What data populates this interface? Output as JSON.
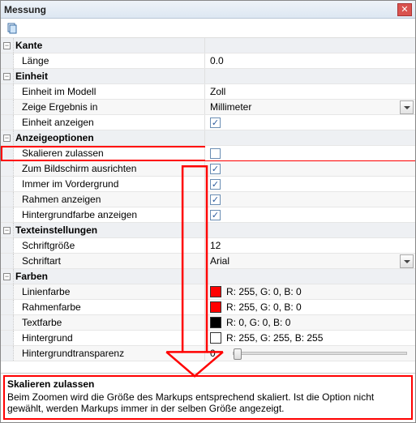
{
  "window": {
    "title": "Messung"
  },
  "sections": {
    "kante": {
      "header": "Kante",
      "laenge": {
        "label": "Länge",
        "value": "0.0"
      }
    },
    "einheit": {
      "header": "Einheit",
      "im_modell": {
        "label": "Einheit im Modell",
        "value": "Zoll"
      },
      "ergebnis_in": {
        "label": "Zeige Ergebnis in",
        "value": "Millimeter"
      },
      "anzeigen": {
        "label": "Einheit anzeigen",
        "checked": true
      }
    },
    "anzeige": {
      "header": "Anzeigeoptionen",
      "skalieren": {
        "label": "Skalieren zulassen",
        "checked": false
      },
      "bildschirm": {
        "label": "Zum Bildschirm ausrichten",
        "checked": true
      },
      "vordergrund": {
        "label": "Immer im Vordergrund",
        "checked": true
      },
      "rahmen": {
        "label": "Rahmen anzeigen",
        "checked": true
      },
      "hg_anzeigen": {
        "label": "Hintergrundfarbe anzeigen",
        "checked": true
      }
    },
    "text": {
      "header": "Texteinstellungen",
      "groesse": {
        "label": "Schriftgröße",
        "value": "12"
      },
      "art": {
        "label": "Schriftart",
        "value": "Arial"
      }
    },
    "farben": {
      "header": "Farben",
      "linie": {
        "label": "Linienfarbe",
        "text": "R: 255, G: 0, B: 0",
        "hex": "#ff0000"
      },
      "rahmen": {
        "label": "Rahmenfarbe",
        "text": "R: 255, G: 0, B: 0",
        "hex": "#ff0000"
      },
      "textf": {
        "label": "Textfarbe",
        "text": "R: 0, G: 0, B: 0",
        "hex": "#000000"
      },
      "hg": {
        "label": "Hintergrund",
        "text": "R: 255, G: 255, B: 255",
        "hex": "#ffffff"
      },
      "transp": {
        "label": "Hintergrundtransparenz",
        "value": "0"
      }
    }
  },
  "description": {
    "title": "Skalieren zulassen",
    "body": "Beim Zoomen wird die Größe des Markups entsprechend skaliert. Ist die Option nicht gewählt, werden Markups immer in der selben Größe angezeigt."
  },
  "glyphs": {
    "check": "✓",
    "minus": "−",
    "close": "✕"
  }
}
